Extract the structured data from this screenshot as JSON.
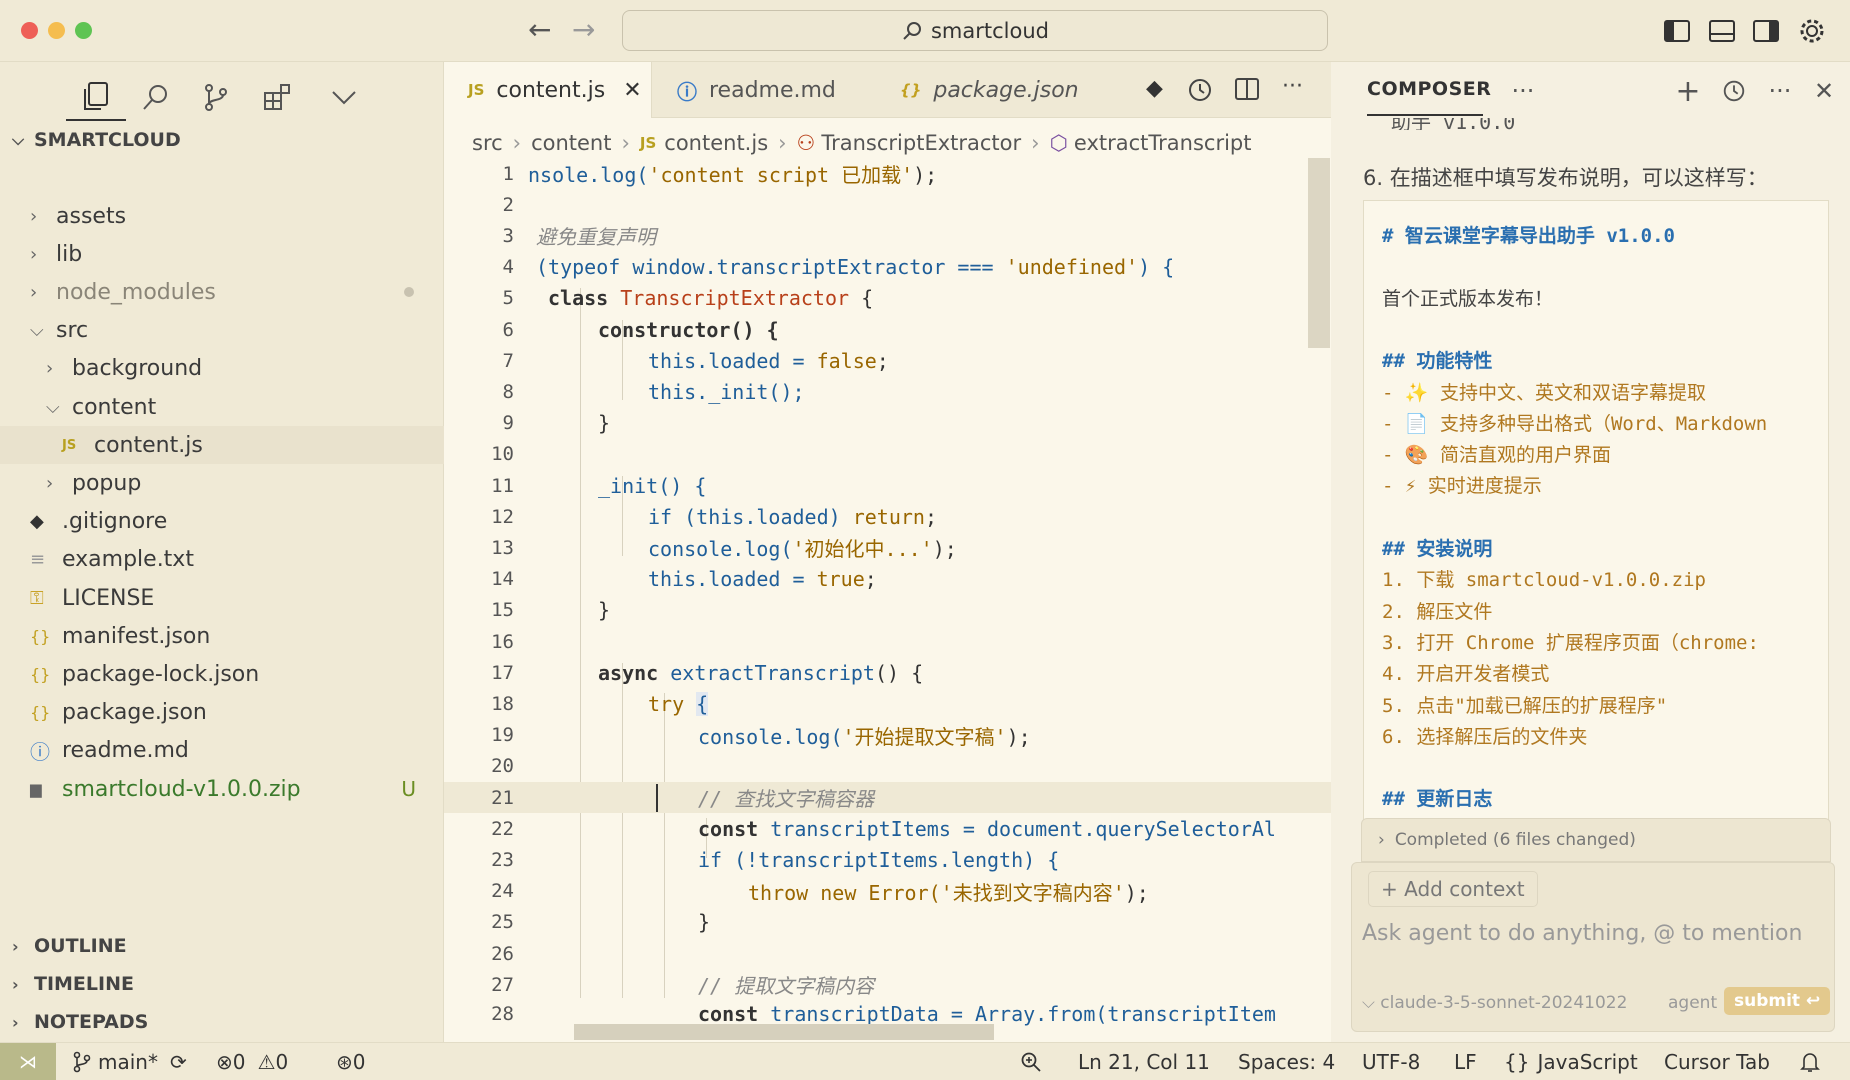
{
  "titlebar": {
    "search_text": "smartcloud"
  },
  "explorer": {
    "root": "SMARTCLOUD",
    "items": [
      {
        "label": "assets",
        "type": "folder",
        "indent": 0,
        "open": false
      },
      {
        "label": "lib",
        "type": "folder",
        "indent": 0,
        "open": false
      },
      {
        "label": "node_modules",
        "type": "folder",
        "indent": 0,
        "open": false,
        "dim": true
      },
      {
        "label": "src",
        "type": "folder",
        "indent": 0,
        "open": true
      },
      {
        "label": "background",
        "type": "folder",
        "indent": 1,
        "open": false
      },
      {
        "label": "content",
        "type": "folder",
        "indent": 1,
        "open": true
      },
      {
        "label": "content.js",
        "type": "js",
        "indent": 2
      },
      {
        "label": "popup",
        "type": "folder",
        "indent": 1,
        "open": false
      },
      {
        "label": ".gitignore",
        "type": "git",
        "indent": 0
      },
      {
        "label": "example.txt",
        "type": "txt",
        "indent": 0
      },
      {
        "label": "LICENSE",
        "type": "license",
        "indent": 0
      },
      {
        "label": "manifest.json",
        "type": "json",
        "indent": 0
      },
      {
        "label": "package-lock.json",
        "type": "json",
        "indent": 0
      },
      {
        "label": "package.json",
        "type": "json",
        "indent": 0
      },
      {
        "label": "readme.md",
        "type": "info",
        "indent": 0
      },
      {
        "label": "smartcloud-v1.0.0.zip",
        "type": "zip",
        "indent": 0,
        "badge": "U"
      }
    ],
    "sections": [
      "OUTLINE",
      "TIMELINE",
      "NOTEPADS"
    ]
  },
  "editor": {
    "tabs": [
      {
        "label": "content.js",
        "icon": "JS"
      },
      {
        "label": "readme.md",
        "icon": "ⓘ"
      },
      {
        "label": "package.json",
        "icon": "{}"
      }
    ],
    "breadcrumb": [
      "src",
      "content",
      "content.js",
      "TranscriptExtractor",
      "extractTranscript"
    ],
    "line_numbers": [
      "1",
      "2",
      "3",
      "4",
      "5",
      "6",
      "7",
      "8",
      "9",
      "10",
      "11",
      "12",
      "13",
      "14",
      "15",
      "16",
      "17",
      "18",
      "19",
      "20",
      "21",
      "22",
      "23",
      "24",
      "25",
      "26",
      "27",
      "28"
    ],
    "code": {
      "l1a": "nsole.log(",
      "l1b": "'content script 已加载'",
      "l1c": ");",
      "l3": "避免重复声明",
      "l4a": "(typeof window.transcriptExtractor === ",
      "l4b": "'undefined'",
      "l4c": ") {",
      "l5a": "class ",
      "l5b": "TranscriptExtractor",
      "l5c": " {",
      "l6": "constructor() {",
      "l7a": "this.loaded = ",
      "l7b": "false",
      "l7c": ";",
      "l8": "this._init();",
      "l9": "}",
      "l11": "_init() {",
      "l12a": "if (this.loaded) ",
      "l12b": "return",
      "l12c": ";",
      "l13a": "console.log(",
      "l13b": "'初始化中...'",
      "l13c": ");",
      "l14a": "this.loaded = ",
      "l14b": "true",
      "l14c": ";",
      "l15": "}",
      "l17a": "async ",
      "l17b": "extractTranscript",
      "l17c": "() {",
      "l18a": "try ",
      "l18b": "{",
      "l19a": "console.log(",
      "l19b": "'开始提取文字稿'",
      "l19c": ");",
      "l21": "// 查找文字稿容器",
      "l22a": "const ",
      "l22b": "transcriptItems = document.querySelectorAl",
      "l23a": "if (!transcriptItems.length) {",
      "l24a": "throw new Error(",
      "l24b": "'未找到文字稿内容'",
      "l24c": ");",
      "l25": "}",
      "l27": "// 提取文字稿内容",
      "l28a": "const ",
      "l28b": "transcriptData = Array.from(transcriptItem"
    }
  },
  "composer": {
    "title": "COMPOSER",
    "cut_text": "助手 v1.0.0",
    "step_text": "6. 在描述框中填写发布说明，可以这样写：",
    "md_lines": [
      {
        "t": "# 智云课堂字幕导出助手 v1.0.0",
        "k": "h"
      },
      {
        "t": "",
        "k": "p"
      },
      {
        "t": "首个正式版本发布！",
        "k": "p"
      },
      {
        "t": "",
        "k": "p"
      },
      {
        "t": "## 功能特性",
        "k": "h"
      },
      {
        "t": "- ✨ 支持中文、英文和双语字幕提取",
        "k": "o"
      },
      {
        "t": "- 📄 支持多种导出格式（Word、Markdown",
        "k": "o"
      },
      {
        "t": "- 🎨 简洁直观的用户界面",
        "k": "o"
      },
      {
        "t": "- ⚡ 实时进度提示",
        "k": "o"
      },
      {
        "t": "",
        "k": "p"
      },
      {
        "t": "## 安装说明",
        "k": "h"
      },
      {
        "t": "1. 下载 smartcloud-v1.0.0.zip",
        "k": "o"
      },
      {
        "t": "2. 解压文件",
        "k": "o"
      },
      {
        "t": "3. 打开 Chrome 扩展程序页面（chrome:",
        "k": "o"
      },
      {
        "t": "4. 开启开发者模式",
        "k": "o"
      },
      {
        "t": "5. 点击\"加载已解压的扩展程序\"",
        "k": "o"
      },
      {
        "t": "6. 选择解压后的文件夹",
        "k": "o"
      },
      {
        "t": "",
        "k": "p"
      },
      {
        "t": "## 更新日志",
        "k": "h"
      }
    ],
    "completed": "Completed (6 files changed)",
    "add_context": "+ Add context",
    "placeholder": "Ask agent to do anything, @ to mention",
    "model": "claude-3-5-sonnet-20241022",
    "mode": "agent",
    "submit": "submit ↩"
  },
  "statusbar": {
    "branch": "main*",
    "errors": "0",
    "warnings": "0",
    "ports": "0",
    "position": "Ln 21, Col 11",
    "spaces": "Spaces: 4",
    "encoding": "UTF-8",
    "eol": "LF",
    "language": "JavaScript",
    "tab_mode": "Cursor Tab"
  },
  "colors": {
    "background": "#F5F0E1",
    "editor_bg": "#FBF7EA",
    "accent_orange": "#B07820",
    "accent_blue": "#2A6FB0"
  }
}
